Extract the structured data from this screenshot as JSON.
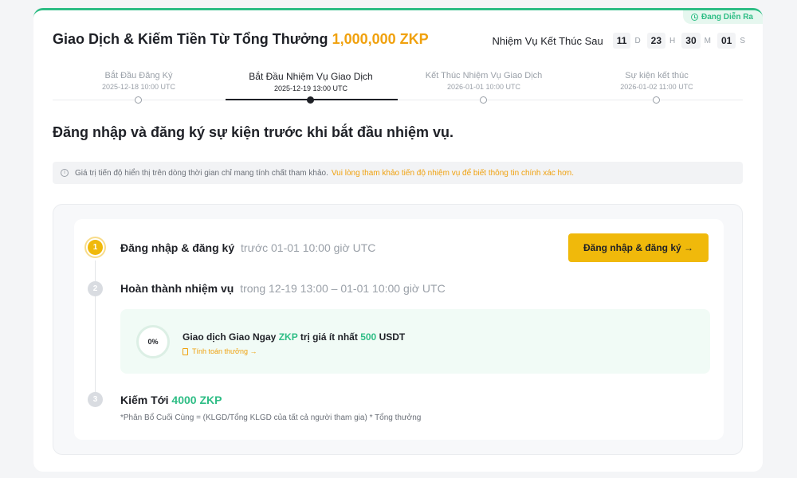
{
  "campaign": {
    "status_badge": "Đang Diễn Ra",
    "title": "Giao Dịch & Kiếm Tiền Từ Tổng Thưởng",
    "reward_pool": "1,000,000 ZKP"
  },
  "countdown": {
    "label": "Nhiệm Vụ Kết Thúc Sau",
    "days": "11",
    "days_unit": "D",
    "hours": "23",
    "hours_unit": "H",
    "minutes": "30",
    "minutes_unit": "M",
    "seconds": "01",
    "seconds_unit": "S"
  },
  "timeline": [
    {
      "name": "Bắt Đầu Đăng Ký",
      "date": "2025-12-18 10:00 UTC",
      "active": false
    },
    {
      "name": "Bắt Đầu Nhiệm Vụ Giao Dịch",
      "date": "2025-12-19 13:00 UTC",
      "active": true
    },
    {
      "name": "Kết Thúc Nhiệm Vụ Giao Dịch",
      "date": "2026-01-01 10:00 UTC",
      "active": false
    },
    {
      "name": "Sự kiện kết thúc",
      "date": "2026-01-02 11:00 UTC",
      "active": false
    }
  ],
  "headline": "Đăng nhập và đăng ký sự kiện trước khi bắt đầu nhiệm vụ.",
  "notice": {
    "text": "Giá trị tiến độ hiển thị trên dòng thời gian chỉ mang tính chất tham khảo.",
    "highlight": "Vui lòng tham khảo tiến độ nhiệm vụ để biết thông tin chính xác hơn."
  },
  "steps": {
    "step1": {
      "num": "1",
      "title": "Đăng nhập & đăng ký",
      "sub": "trước 01-01 10:00 giờ UTC",
      "button": "Đăng nhập & đăng ký →"
    },
    "step2": {
      "num": "2",
      "title": "Hoàn thành nhiệm vụ",
      "sub": "trong 12-19 13:00 – 01-01 10:00 giờ UTC"
    },
    "step3": {
      "num": "3",
      "title": "Kiếm Tới",
      "reward": "4000 ZKP",
      "formula": "*Phân Bổ Cuối Cùng = (KLGD/Tổng KLGD của tất cả người tham gia) * Tổng thưởng"
    }
  },
  "task": {
    "progress": "0%",
    "progress_value": 0,
    "text_prefix": "Giao dịch Giao Ngay",
    "token": "ZKP",
    "text_mid": "trị giá ít nhất",
    "amount": "500",
    "currency": "USDT",
    "link": "Tính toán thưởng →"
  },
  "colors": {
    "accent_green": "#2ebd85",
    "accent_yellow": "#f0b90b",
    "accent_orange": "#f0a10e",
    "text_primary": "#1e2026",
    "text_muted": "#9aa0a8"
  }
}
